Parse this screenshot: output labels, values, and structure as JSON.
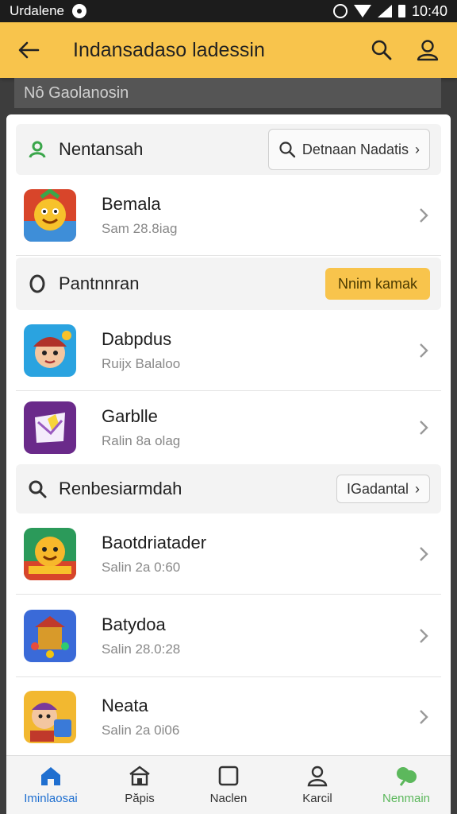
{
  "status_bar": {
    "carrier": "Urdalene",
    "time": "10:40"
  },
  "app_bar": {
    "title": "Indansadaso ladessin",
    "icons": [
      "back-arrow-icon",
      "search-icon",
      "user-icon"
    ]
  },
  "search_strip": {
    "text": "Nô Gaolanosin"
  },
  "sections": [
    {
      "title": "Nentansah",
      "icon": "person-icon",
      "button_label": "Detnaan Nadatis"
    },
    {
      "title": "Pantnnran",
      "icon": "circle-icon",
      "button_label": "Nnim kamak"
    },
    {
      "title": "Renbesiarmdah",
      "icon": "search-icon",
      "button_label": "IGadantal"
    }
  ],
  "items": [
    {
      "title": "Bemala",
      "subtitle": "Sam 28.8iag"
    },
    {
      "title": "Dabpdus",
      "subtitle": "Ruijx Balaloo"
    },
    {
      "title": "Garblle",
      "subtitle": "Ralin 8a olag"
    },
    {
      "title": "Baotdriatader",
      "subtitle": "Salin 2a 0:60"
    },
    {
      "title": "Batydoa",
      "subtitle": "Salin 28.0:28"
    },
    {
      "title": "Neata",
      "subtitle": "Salin 2a 0i06"
    }
  ],
  "bottom_nav": [
    {
      "label": "Iminlaosai",
      "icon": "home-icon"
    },
    {
      "label": "Păpis",
      "icon": "building-icon"
    },
    {
      "label": "Naclen",
      "icon": "square-icon"
    },
    {
      "label": "Karcil",
      "icon": "person-icon"
    },
    {
      "label": "Nenmain",
      "icon": "leaf-icon"
    }
  ],
  "colors": {
    "accent": "#f8c44c",
    "active_blue": "#1f6fd0",
    "active_green": "#5cb85c"
  }
}
